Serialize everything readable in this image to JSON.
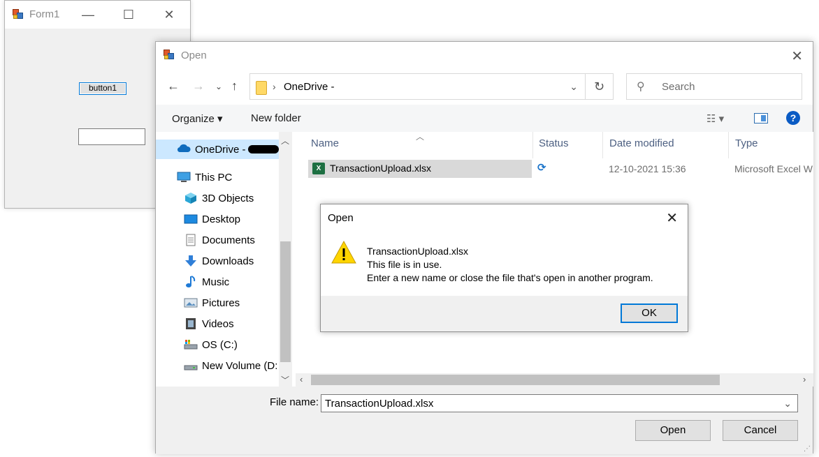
{
  "form1": {
    "title": "Form1",
    "button_label": "button1",
    "textbox_value": "",
    "icons": [
      "app-icon",
      "minimize-icon",
      "maximize-icon",
      "close-icon"
    ]
  },
  "open_dialog": {
    "title": "Open",
    "address_path": "OneDrive -",
    "search_placeholder": "Search",
    "toolbar": {
      "organize": "Organize ▾",
      "new_folder": "New folder"
    },
    "sidebar": {
      "onedrive": "OneDrive -",
      "items": [
        {
          "label": "This PC",
          "icon": "computer-icon"
        },
        {
          "label": "3D Objects",
          "icon": "cube-icon"
        },
        {
          "label": "Desktop",
          "icon": "desktop-icon"
        },
        {
          "label": "Documents",
          "icon": "document-icon"
        },
        {
          "label": "Downloads",
          "icon": "download-icon"
        },
        {
          "label": "Music",
          "icon": "music-icon"
        },
        {
          "label": "Pictures",
          "icon": "picture-icon"
        },
        {
          "label": "Videos",
          "icon": "video-icon"
        },
        {
          "label": "OS (C:)",
          "icon": "drive-icon"
        },
        {
          "label": "New Volume (D:",
          "icon": "drive-icon"
        }
      ]
    },
    "columns": {
      "name": "Name",
      "status": "Status",
      "date": "Date modified",
      "type": "Type"
    },
    "file": {
      "name": "TransactionUpload.xlsx",
      "status_icon": "sync-icon",
      "date": "12-10-2021 15:36",
      "type": "Microsoft Excel W"
    },
    "file_name_label": "File name:",
    "file_name_value": "TransactionUpload.xlsx",
    "open_button": "Open",
    "cancel_button": "Cancel",
    "accent": "#0078d7"
  },
  "message_box": {
    "title": "Open",
    "line1": "TransactionUpload.xlsx",
    "line2": "This file is in use.",
    "line3": "Enter a new name or close the file that's open in another program.",
    "ok": "OK",
    "icon": "warning-icon"
  }
}
